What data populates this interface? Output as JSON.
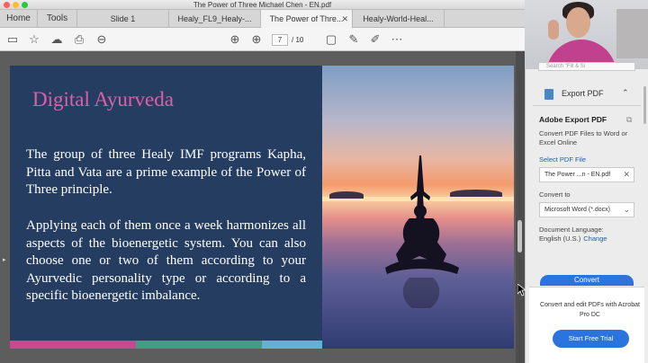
{
  "window": {
    "title": "The Power of Three Michael Chen - EN.pdf"
  },
  "tabs": [
    {
      "label": "Home"
    },
    {
      "label": "Tools"
    },
    {
      "label": "Slide 1"
    },
    {
      "label": "Healy_FL9_Healy-..."
    },
    {
      "label": "The Power of Thre..."
    },
    {
      "label": "Healy-World-Heal..."
    }
  ],
  "toolbar": {
    "page_current": "7",
    "page_total": "/ 10"
  },
  "slide": {
    "title": "Digital Ayurveda",
    "paragraph1": "The group of three Healy IMF programs Kapha, Pitta and Vata are a prime example of the Power of Three principle.",
    "paragraph2": "Applying each of them once a week harmonizes all aspects of the bioenergetic system. You can also choose one or two of them according to your Ayurvedic personality type or according to a specific bioenergetic imbalance.",
    "bar_colors": [
      "#c84a8e",
      "#3f9f82",
      "#5fb4d6"
    ]
  },
  "panel": {
    "search_stub": "Search \"Fill & Si",
    "export_label": "Export PDF",
    "title": "Adobe Export PDF",
    "description": "Convert PDF Files to Word or Excel Online",
    "select_file_link": "Select PDF File",
    "selected_file": "The Power ...n - EN.pdf",
    "convert_to_label": "Convert to",
    "convert_to_value": "Microsoft Word (*.docx)",
    "doc_language_label": "Document Language:",
    "doc_language_value": "English (U.S.)",
    "change_link": "Change",
    "convert_button": "Convert",
    "promo_text": "Convert and edit PDFs with Acrobat Pro DC",
    "trial_button": "Start Free Trial"
  },
  "colors": {
    "accent": "#2c74dd",
    "slide_bg": "#263d62",
    "title_pink": "#e05ea9"
  },
  "icons": [
    "save-icon",
    "bookmark-icon",
    "upload-icon",
    "print-icon",
    "zoom-icon",
    "page-up-icon",
    "page-down-icon",
    "comment-icon",
    "pen-icon",
    "sign-icon",
    "more-tools-icon"
  ]
}
